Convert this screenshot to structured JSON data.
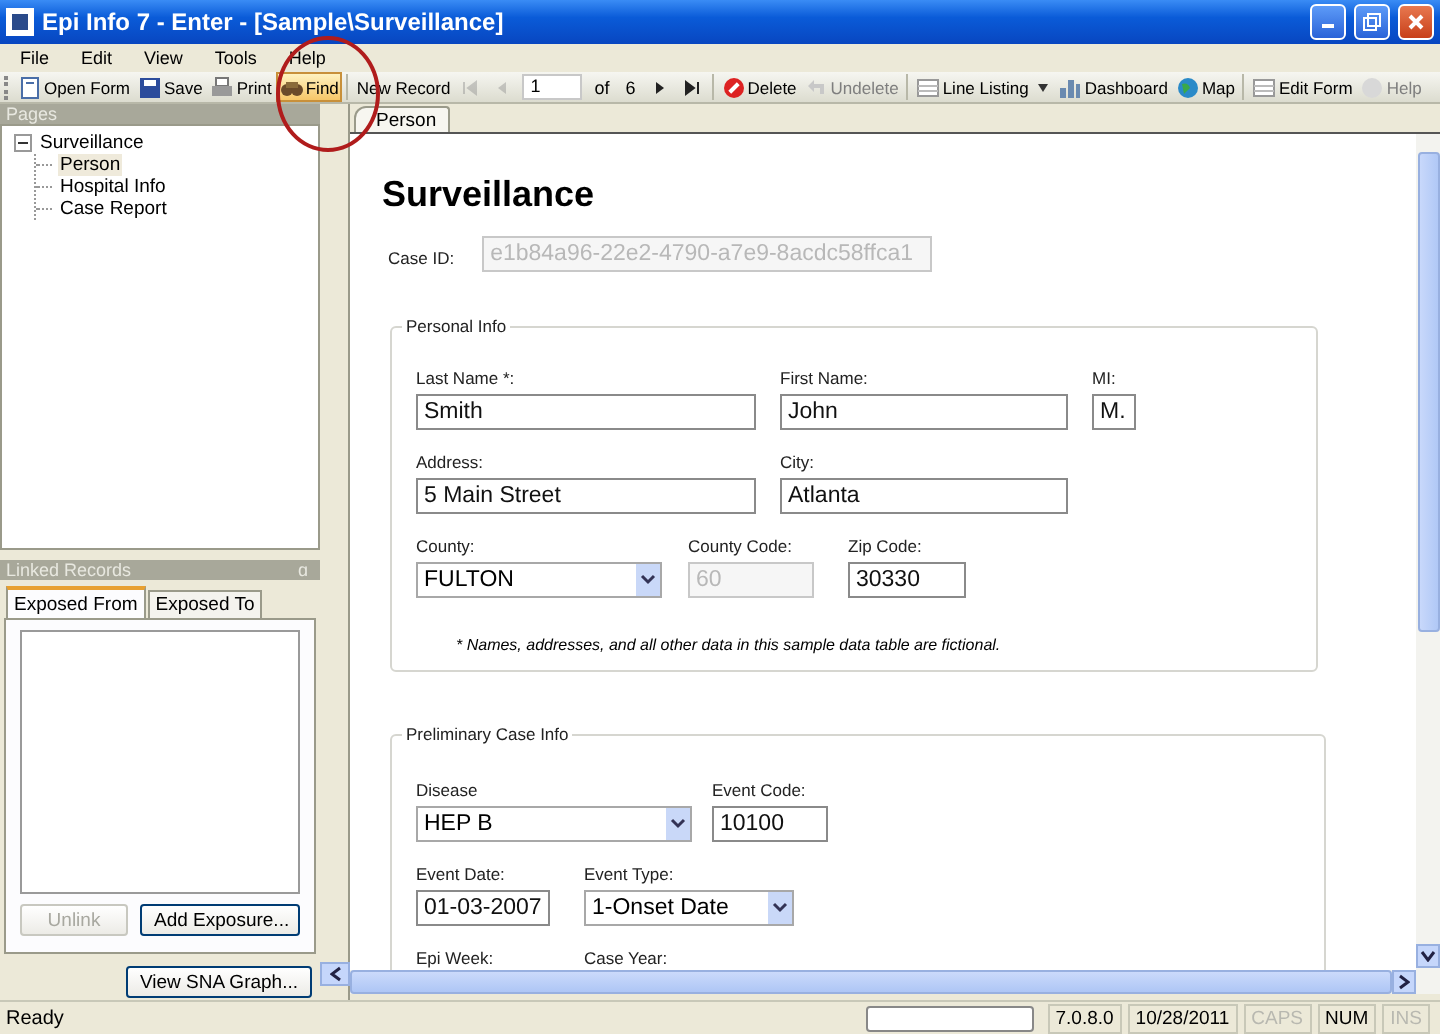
{
  "window": {
    "title": "Epi Info 7 - Enter - [Sample\\Surveillance]"
  },
  "menu": [
    "File",
    "Edit",
    "View",
    "Tools",
    "Help"
  ],
  "toolbar": {
    "items": [
      {
        "kind": "button",
        "label": "Open Form",
        "disabled": false,
        "highlighted": false
      },
      {
        "kind": "button",
        "label": "Save",
        "disabled": false,
        "highlighted": false
      },
      {
        "kind": "button",
        "label": "Print",
        "disabled": false,
        "highlighted": false
      },
      {
        "kind": "button",
        "label": "Find",
        "disabled": false,
        "highlighted": true
      },
      {
        "kind": "separator"
      },
      {
        "kind": "button",
        "label": "New Record",
        "disabled": false,
        "highlighted": false
      },
      {
        "kind": "nav",
        "disabled": true
      },
      {
        "kind": "nav",
        "disabled": true
      },
      {
        "kind": "record",
        "value": "1",
        "of": "of",
        "count": "6"
      },
      {
        "kind": "nav",
        "disabled": false
      },
      {
        "kind": "nav",
        "disabled": false
      },
      {
        "kind": "separator"
      },
      {
        "kind": "button",
        "label": "Delete",
        "disabled": false,
        "highlighted": false
      },
      {
        "kind": "button",
        "label": "Undelete",
        "disabled": true,
        "highlighted": false
      },
      {
        "kind": "separator"
      },
      {
        "kind": "button",
        "label": "Line Listing",
        "disabled": false,
        "highlighted": false
      },
      {
        "kind": "dropdown"
      },
      {
        "kind": "button",
        "label": "Dashboard",
        "disabled": false,
        "highlighted": false
      },
      {
        "kind": "button",
        "label": "Map",
        "disabled": false,
        "highlighted": false
      },
      {
        "kind": "separator"
      },
      {
        "kind": "button",
        "label": "Edit Form",
        "disabled": false,
        "highlighted": false
      },
      {
        "kind": "button",
        "label": "Help",
        "disabled": true,
        "highlighted": false
      }
    ]
  },
  "pages": {
    "header": "Pages",
    "tree": [
      {
        "label": "Surveillance",
        "expanded": true,
        "selected": false,
        "children": [
          {
            "label": "Person",
            "selected": true
          },
          {
            "label": "Hospital Info",
            "selected": false
          },
          {
            "label": "Case Report",
            "selected": false
          }
        ]
      }
    ]
  },
  "linked_records": {
    "header": "Linked Records",
    "pin": "ɑ",
    "tabs": [
      {
        "label": "Exposed From",
        "selected": true
      },
      {
        "label": "Exposed To",
        "selected": false
      }
    ],
    "buttons": [
      {
        "label": "Unlink",
        "disabled": true
      },
      {
        "label": "Add Exposure...",
        "disabled": false
      }
    ],
    "graph_button": "View SNA Graph..."
  },
  "form_tabs": [
    {
      "label": "Person",
      "selected": true
    }
  ],
  "form": {
    "title": "Surveillance",
    "case_id": {
      "label": "Case ID:",
      "value": "e1b84a96-22e2-4790-a7e9-8acdc58ffca1",
      "disabled": true
    },
    "groups": [
      {
        "title": "Personal Info",
        "rows": [
          [
            {
              "label": "Last Name *:",
              "value": "Smith",
              "kind": "text",
              "disabled": false
            },
            {
              "label": "First Name:",
              "value": "John",
              "kind": "text",
              "disabled": false
            },
            {
              "label": "MI:",
              "value": "M.",
              "kind": "text",
              "disabled": false
            }
          ],
          [
            {
              "label": "Address:",
              "value": "5 Main Street",
              "kind": "text",
              "disabled": false
            },
            {
              "label": "City:",
              "value": "Atlanta",
              "kind": "text",
              "disabled": false
            }
          ],
          [
            {
              "label": "County:",
              "value": "FULTON",
              "kind": "dropdown"
            },
            {
              "label": "County Code:",
              "value": "60",
              "kind": "text",
              "disabled": true
            },
            {
              "label": "Zip Code:",
              "value": "30330",
              "kind": "text",
              "disabled": false
            }
          ]
        ],
        "note": "* Names, addresses, and all other data in this sample data table are fictional."
      },
      {
        "title": "Preliminary Case Info",
        "rows": [
          [
            {
              "label": "Disease",
              "value": "HEP B",
              "kind": "dropdown"
            },
            {
              "label": "Event Code:",
              "value": "10100",
              "kind": "text",
              "disabled": false
            }
          ],
          [
            {
              "label": "Event Date:",
              "value": "01-03-2007",
              "kind": "text",
              "disabled": false
            },
            {
              "label": "Event Type:",
              "value": "1-Onset Date",
              "kind": "dropdown"
            }
          ],
          [
            {
              "label": "Epi Week:"
            },
            {
              "label": "Case Year:"
            }
          ]
        ]
      }
    ]
  },
  "status_bar": {
    "text": "Ready",
    "panels": [
      {
        "text": "7.0.8.0",
        "disabled": false
      },
      {
        "text": "10/28/2011",
        "disabled": false
      },
      {
        "text": "CAPS",
        "disabled": true
      },
      {
        "text": "NUM",
        "disabled": false
      },
      {
        "text": "INS",
        "disabled": true
      }
    ]
  }
}
